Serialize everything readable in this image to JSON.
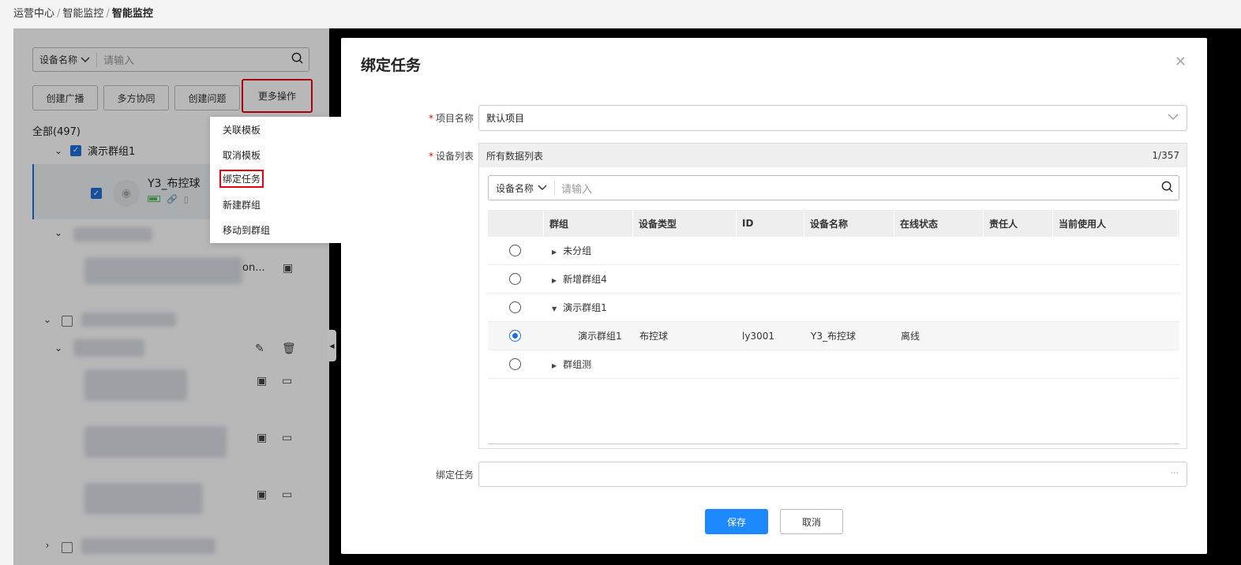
{
  "breadcrumb": {
    "items": [
      "运营中心",
      "智能监控"
    ],
    "current": "智能监控"
  },
  "left": {
    "search": {
      "type_label": "设备名称",
      "placeholder": "请输入"
    },
    "buttons": [
      "创建广播",
      "多方协同",
      "创建问题",
      "更多操作"
    ],
    "all_count": "全部(497)",
    "group_name": "演示群组1",
    "device_name": "Y3_布控球",
    "truncated_text": "on..."
  },
  "dropdown": {
    "items": [
      "关联模板",
      "取消模板",
      "绑定任务",
      "新建群组",
      "移动到群组"
    ],
    "active": "绑定任务"
  },
  "modal": {
    "title": "绑定任务",
    "close_icon": "close-icon",
    "project": {
      "label": "项目名称",
      "value": "默认项目"
    },
    "device_list": {
      "label": "设备列表",
      "header_title": "所有数据列表",
      "page_count": "1/357",
      "search": {
        "type_label": "设备名称",
        "placeholder": "请输入"
      },
      "columns": [
        "群组",
        "设备类型",
        "ID",
        "设备名称",
        "在线状态",
        "责任人",
        "当前使用人"
      ],
      "rows": [
        {
          "group": "未分组",
          "expanded": false,
          "selected": false
        },
        {
          "group": "新增群组4",
          "expanded": false,
          "selected": false
        },
        {
          "group": "演示群组1",
          "expanded": true,
          "selected": false
        },
        {
          "group": "演示群组1",
          "type": "布控球",
          "id": "ly3001",
          "name": "Y3_布控球",
          "status": "离线",
          "child": true,
          "selected": true
        },
        {
          "group": "群组测",
          "expanded": false,
          "selected": false
        }
      ]
    },
    "task": {
      "label": "绑定任务",
      "value": "",
      "more": "···"
    },
    "save_label": "保存",
    "cancel_label": "取消"
  },
  "colors": {
    "primary": "#1e88ff",
    "highlight": "#e60012",
    "checkbox": "#1e6fd9"
  }
}
